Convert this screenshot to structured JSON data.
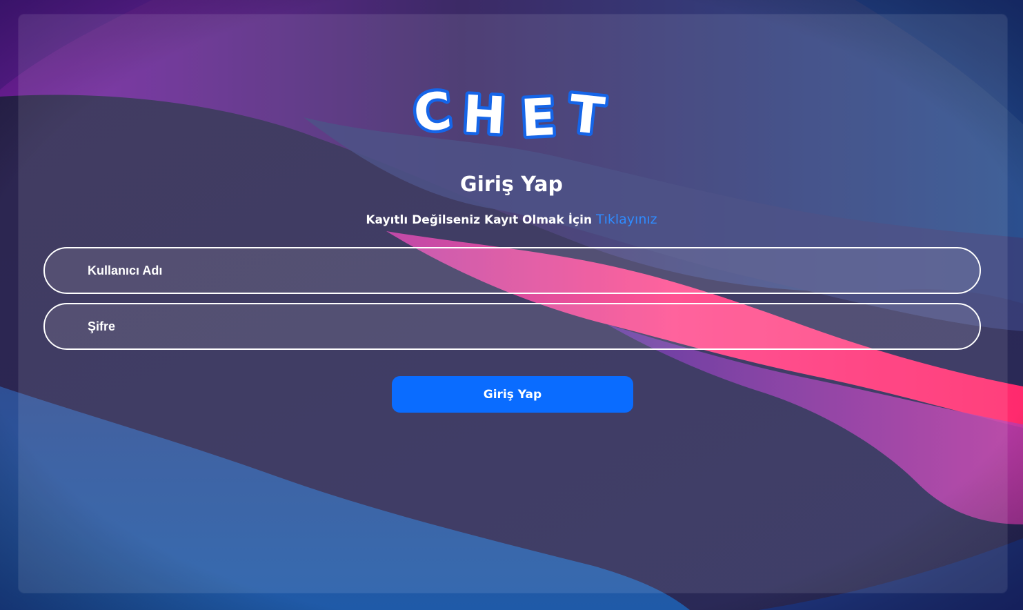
{
  "logo": {
    "text": "CHET",
    "letters": [
      "C",
      "H",
      "E",
      "T"
    ]
  },
  "login": {
    "title": "Giriş Yap",
    "subtitle_prefix": "Kayıtlı Değilseniz Kayıt Olmak İçin ",
    "register_link": "Tıklayınız",
    "username_placeholder": "Kullanıcı Adı",
    "password_placeholder": "Şifre",
    "submit_label": "Giriş Yap"
  },
  "colors": {
    "accent": "#0a6cff",
    "link": "#2f8cff",
    "logo_outline": "#1565e8",
    "text": "#ffffff"
  }
}
